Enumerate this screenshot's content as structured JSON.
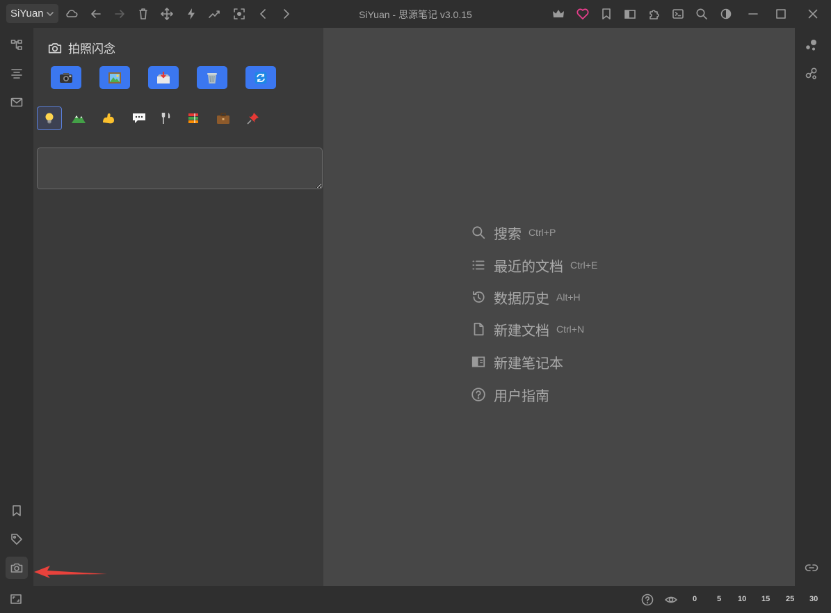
{
  "titlebar": {
    "brand": "SiYuan",
    "title": "SiYuan - 思源笔记 v3.0.15",
    "toolbar_icons": [
      "cloud-sync-icon",
      "back-icon",
      "forward-icon",
      "trash-icon",
      "move-icon",
      "lightning-icon",
      "graph-trend-icon",
      "focus-icon",
      "chevron-left-icon",
      "chevron-right-icon"
    ],
    "right_icons": [
      "crown-icon",
      "heart-icon",
      "bookmark-icon",
      "layout-icon",
      "plugin-icon",
      "terminal-icon",
      "search-icon",
      "theme-icon",
      "minimize-icon",
      "maximize-icon",
      "close-icon"
    ],
    "heart_color": "#e83e8c"
  },
  "left_dock": {
    "top_icons": [
      "file-tree-icon",
      "outline-icon",
      "inbox-icon"
    ],
    "bottom_icons": [
      "bookmark-icon",
      "tag-icon",
      "camera-icon"
    ]
  },
  "flash_panel": {
    "title": "拍照闪念",
    "actions": [
      "camera",
      "picture",
      "inbox-tray",
      "wastebasket",
      "refresh"
    ],
    "tags": [
      "bulb",
      "mountain",
      "muscle",
      "speech",
      "fork-knife",
      "books",
      "briefcase",
      "pushpin"
    ],
    "selected_tag": "bulb",
    "input_value": "",
    "accent": "#3b77f0"
  },
  "editor": {
    "empty_actions": [
      {
        "icon": "search-icon",
        "label": "搜索",
        "shortcut": "Ctrl+P"
      },
      {
        "icon": "list-icon",
        "label": "最近的文档",
        "shortcut": "Ctrl+E"
      },
      {
        "icon": "history-icon",
        "label": "数据历史",
        "shortcut": "Alt+H"
      },
      {
        "icon": "file-icon",
        "label": "新建文档",
        "shortcut": "Ctrl+N"
      },
      {
        "icon": "notebook-icon",
        "label": "新建笔记本",
        "shortcut": ""
      },
      {
        "icon": "help-icon",
        "label": "用户指南",
        "shortcut": ""
      }
    ]
  },
  "right_dock": {
    "icons": [
      "graph-icon",
      "global-graph-icon",
      "backlink-icon"
    ]
  },
  "statusbar": {
    "icons": [
      "fullscreen-icon",
      "help-icon",
      "eye-icon"
    ],
    "zoom_levels": [
      "0",
      "5",
      "10",
      "15",
      "25",
      "30"
    ]
  },
  "annotation": {
    "color": "#e8423c"
  }
}
